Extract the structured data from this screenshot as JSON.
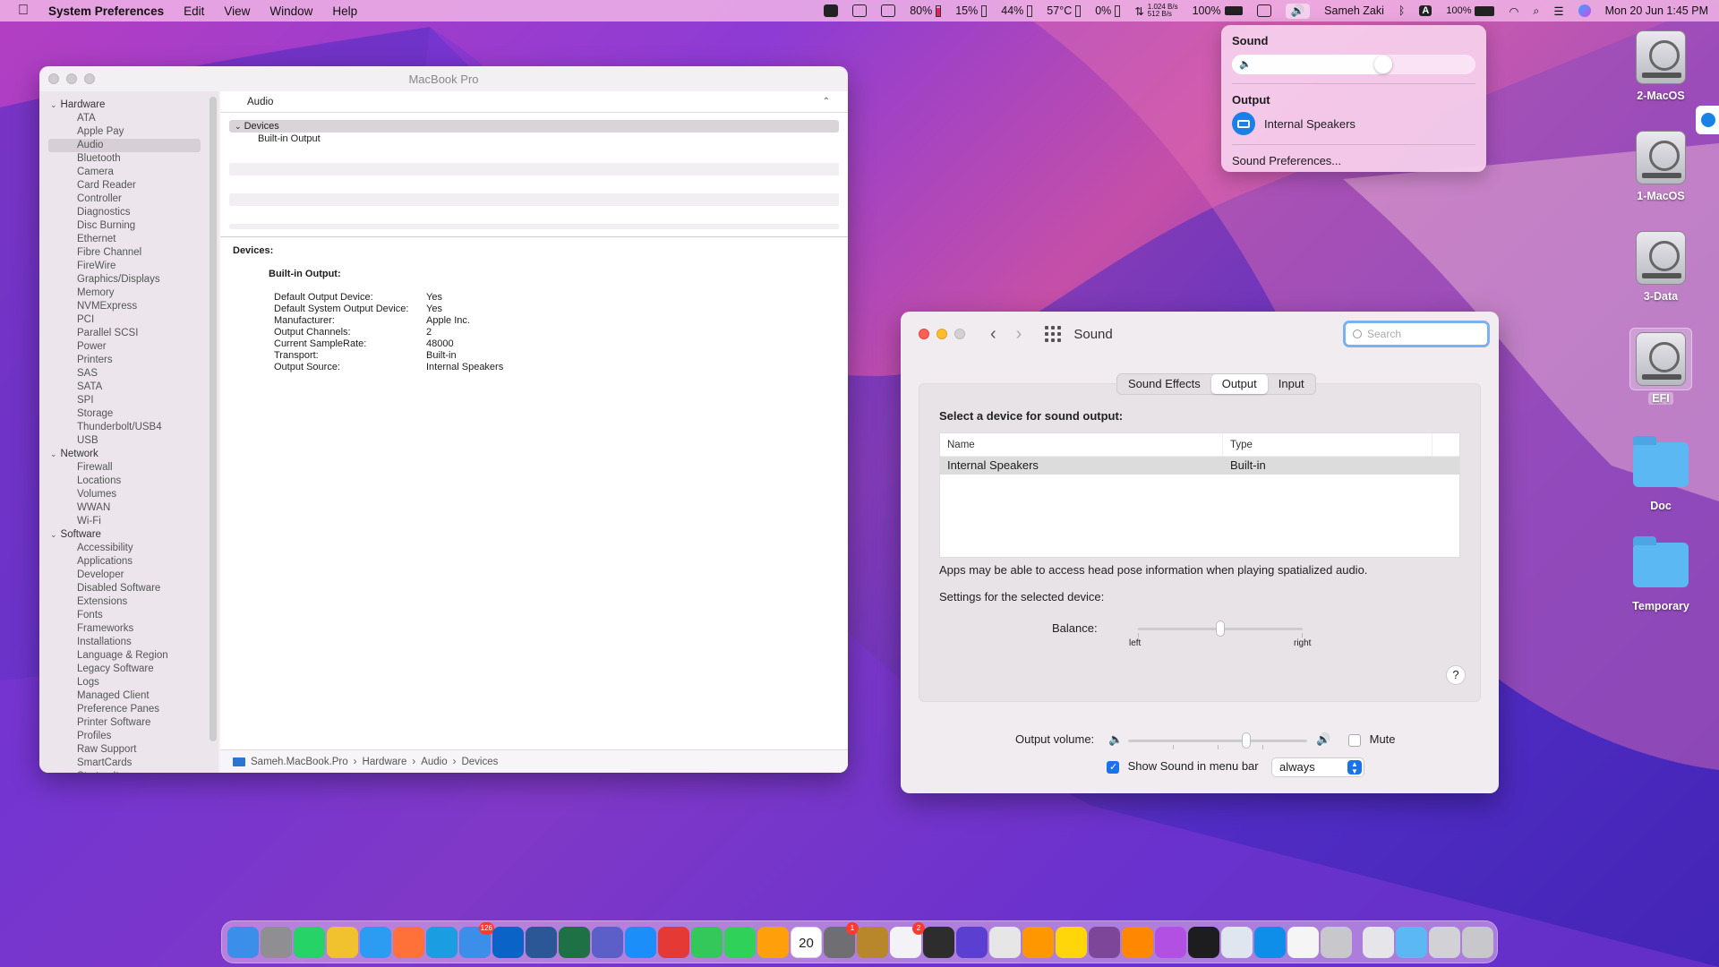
{
  "menubar": {
    "app_name": "System Preferences",
    "menus": [
      "Edit",
      "View",
      "Window",
      "Help"
    ],
    "stats": {
      "cpu": "80%",
      "cpu_level": 0.8,
      "gpu": "15%",
      "mem": "44%",
      "temp": "57°C",
      "disk": "0%",
      "net_up": "1.024 B/s",
      "net_down": "512 B/s",
      "battery_app": "100%"
    },
    "user": "Sameh Zaki",
    "battery": "100%",
    "datetime": "Mon 20 Jun  1:45 PM",
    "input_letter": "A"
  },
  "sound_menu": {
    "title": "Sound",
    "volume_level": 0.62,
    "output_heading": "Output",
    "output_device": "Internal Speakers",
    "prefs_link": "Sound Preferences..."
  },
  "desktop": {
    "items": [
      "2-MacOS",
      "1-MacOS",
      "3-Data",
      "EFI",
      "Doc",
      "Temporary"
    ]
  },
  "sysinfo": {
    "window_title": "MacBook Pro",
    "sidebar": {
      "hardware_label": "Hardware",
      "hardware": [
        "ATA",
        "Apple Pay",
        "Audio",
        "Bluetooth",
        "Camera",
        "Card Reader",
        "Controller",
        "Diagnostics",
        "Disc Burning",
        "Ethernet",
        "Fibre Channel",
        "FireWire",
        "Graphics/Displays",
        "Memory",
        "NVMExpress",
        "PCI",
        "Parallel SCSI",
        "Power",
        "Printers",
        "SAS",
        "SATA",
        "SPI",
        "Storage",
        "Thunderbolt/USB4",
        "USB"
      ],
      "network_label": "Network",
      "network": [
        "Firewall",
        "Locations",
        "Volumes",
        "WWAN",
        "Wi-Fi"
      ],
      "software_label": "Software",
      "software": [
        "Accessibility",
        "Applications",
        "Developer",
        "Disabled Software",
        "Extensions",
        "Fonts",
        "Frameworks",
        "Installations",
        "Language & Region",
        "Legacy Software",
        "Logs",
        "Managed Client",
        "Preference Panes",
        "Printer Software",
        "Profiles",
        "Raw Support",
        "SmartCards",
        "Startup Items"
      ]
    },
    "header": "Audio",
    "tree": {
      "group": "Devices",
      "child": "Built-in Output"
    },
    "detail": {
      "heading": "Devices:",
      "subheading": "Built-in Output:",
      "rows": [
        {
          "k": "Default Output Device:",
          "v": "Yes"
        },
        {
          "k": "Default System Output Device:",
          "v": "Yes"
        },
        {
          "k": "Manufacturer:",
          "v": "Apple Inc."
        },
        {
          "k": "Output Channels:",
          "v": "2"
        },
        {
          "k": "Current SampleRate:",
          "v": "48000"
        },
        {
          "k": "Transport:",
          "v": "Built-in"
        },
        {
          "k": "Output Source:",
          "v": "Internal Speakers"
        }
      ]
    },
    "path": [
      "Sameh.MacBook.Pro",
      "Hardware",
      "Audio",
      "Devices"
    ]
  },
  "sound_prefs": {
    "title": "Sound",
    "search_placeholder": "Search",
    "tabs": [
      "Sound Effects",
      "Output",
      "Input"
    ],
    "active_tab": "Output",
    "select_label": "Select a device for sound output:",
    "col_name": "Name",
    "col_type": "Type",
    "device_name": "Internal Speakers",
    "device_type": "Built-in",
    "spatial_note": "Apps may be able to access head pose information when playing spatialized audio.",
    "settings_label": "Settings for the selected device:",
    "balance_label": "Balance:",
    "balance_left": "left",
    "balance_right": "right",
    "balance_value": 0.5,
    "help": "?",
    "output_volume_label": "Output volume:",
    "output_volume_value": 0.66,
    "mute_label": "Mute",
    "show_in_menu_label": "Show Sound in menu bar",
    "show_in_menu_option": "always"
  },
  "dock": {
    "apps": [
      {
        "name": "finder",
        "color": "#3b8fe8"
      },
      {
        "name": "launchpad",
        "color": "#8e8e93"
      },
      {
        "name": "whatsapp",
        "color": "#25d366"
      },
      {
        "name": "chrome",
        "color": "#f2c12e"
      },
      {
        "name": "safari",
        "color": "#2b9cf2"
      },
      {
        "name": "firefox",
        "color": "#ff7139"
      },
      {
        "name": "edge",
        "color": "#1b9de2"
      },
      {
        "name": "mail",
        "color": "#3b8fe8",
        "badge": "126"
      },
      {
        "name": "outlook",
        "color": "#0a64c8"
      },
      {
        "name": "word",
        "color": "#2b5797"
      },
      {
        "name": "excel",
        "color": "#1e7145"
      },
      {
        "name": "teams",
        "color": "#5b5fc7"
      },
      {
        "name": "app-store",
        "color": "#1c8ef9"
      },
      {
        "name": "anydesk",
        "color": "#e53935"
      },
      {
        "name": "facetime",
        "color": "#34c759"
      },
      {
        "name": "messages",
        "color": "#30d158"
      },
      {
        "name": "photos",
        "color": "#ff9f0a"
      },
      {
        "name": "calendar",
        "color": "#ffffff",
        "label": "20"
      },
      {
        "name": "system-preferences",
        "color": "#6e6e73",
        "badge": "1"
      },
      {
        "name": "parallels",
        "color": "#b8862b"
      },
      {
        "name": "reminders",
        "color": "#f2f2f7",
        "badge": "2"
      },
      {
        "name": "vnc-viewer",
        "color": "#2d2d2d"
      },
      {
        "name": "virtual-machine",
        "color": "#5b3fd1"
      },
      {
        "name": "script-editor",
        "color": "#e6e6e6"
      },
      {
        "name": "sublime-text",
        "color": "#ff9800"
      },
      {
        "name": "notes",
        "color": "#ffd60a"
      },
      {
        "name": "tor-browser",
        "color": "#7d4698"
      },
      {
        "name": "vlc",
        "color": "#ff8800"
      },
      {
        "name": "podcasts",
        "color": "#b150e2"
      },
      {
        "name": "terminal",
        "color": "#1d1d1f"
      },
      {
        "name": "preview",
        "color": "#dfe6f0"
      },
      {
        "name": "teamviewer",
        "color": "#0e8ee9"
      },
      {
        "name": "textedit",
        "color": "#f5f5f5"
      },
      {
        "name": "automator",
        "color": "#c7c7cc"
      },
      {
        "name": "documents",
        "color": "#e5e5ea"
      },
      {
        "name": "downloads",
        "color": "#5cb8f2"
      },
      {
        "name": "screenshots-folder",
        "color": "#d1d1d6"
      },
      {
        "name": "trash",
        "color": "#c7c7cc"
      }
    ]
  }
}
